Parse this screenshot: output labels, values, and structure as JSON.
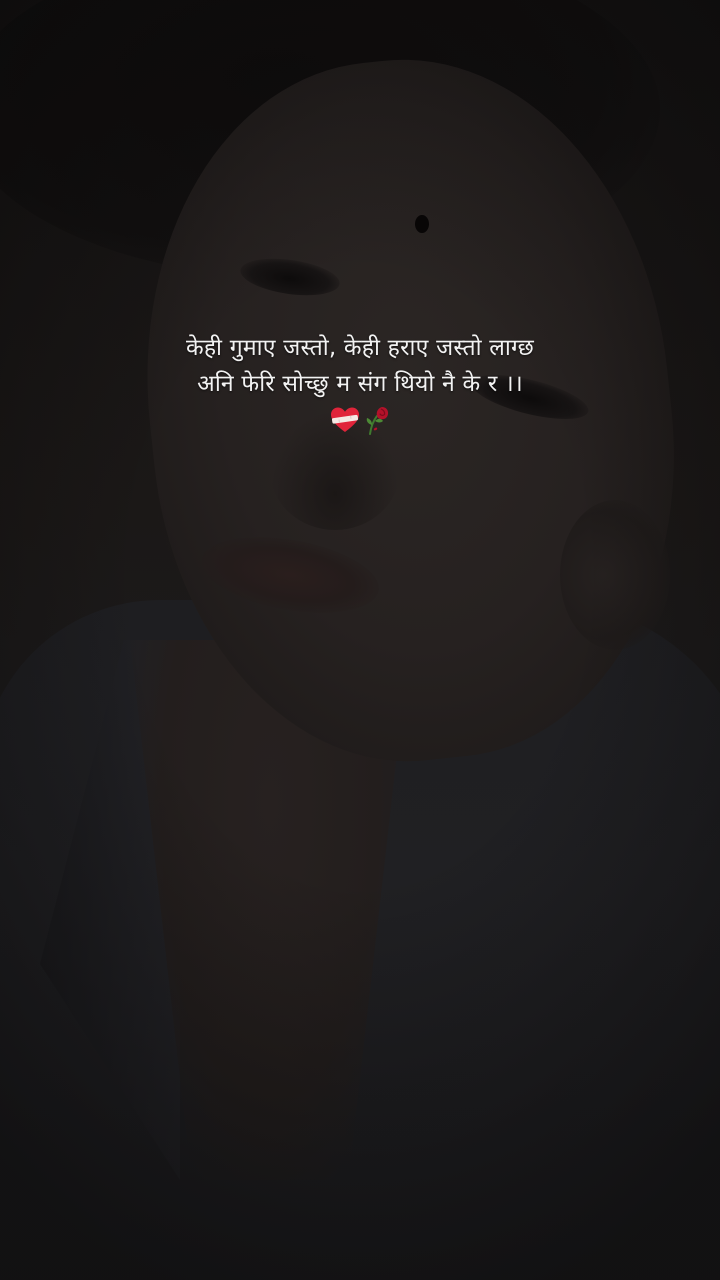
{
  "caption": {
    "line1": "केही गुमाए जस्तो, केही हराए जस्तो लाग्छ",
    "line2": "अनि फेरि सोच्छु म संग थियो नै के र ।।",
    "emojis": [
      "mending-heart-icon",
      "wilted-flower-icon"
    ]
  },
  "colors": {
    "background": "#151414",
    "caption_text": "#f2f2f2",
    "heart": "#e0243a",
    "rose": "#b3122a"
  }
}
